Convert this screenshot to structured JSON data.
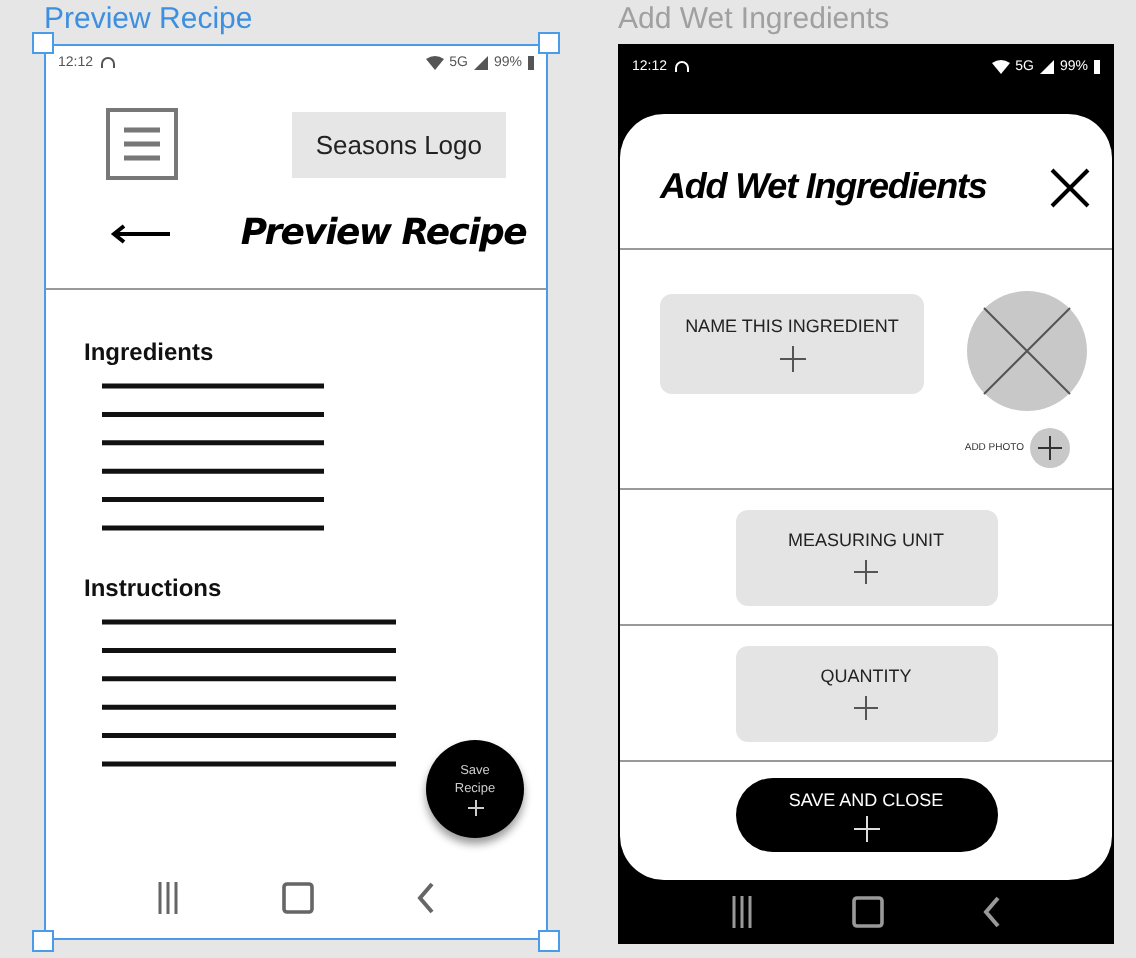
{
  "frames": [
    {
      "kind": "preview",
      "label": "Preview Recipe",
      "selected": true,
      "status": {
        "time": "12:12",
        "network": "5G",
        "battery": "99%"
      },
      "logo": "Seasons Logo",
      "title": "Preview Recipe",
      "sections": [
        {
          "heading": "Ingredients"
        },
        {
          "heading": "Instructions"
        }
      ],
      "fab": "Save Recipe"
    },
    {
      "kind": "sheet",
      "label": "Add Wet Ingredients",
      "selected": false,
      "status": {
        "time": "12:12",
        "network": "5G",
        "battery": "99%"
      },
      "title": "Add Wet Ingredients",
      "fields": [
        {
          "label": "NAME THIS INGREDIENT"
        },
        {
          "label": "MEASURING UNIT"
        },
        {
          "label": "QUANTITY"
        }
      ],
      "photo": "ADD PHOTO",
      "button": "SAVE AND CLOSE"
    }
  ]
}
